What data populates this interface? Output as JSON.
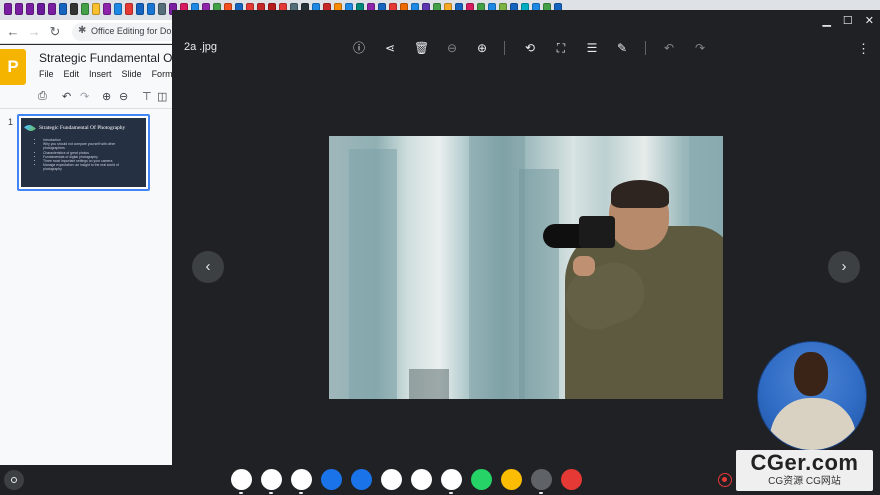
{
  "browser": {
    "tab_colors": [
      "#7b1fa2",
      "#7b1fa2",
      "#7b1fa2",
      "#6a1b9a",
      "#7b1fa2",
      "#1565c0",
      "#333333",
      "#43a047",
      "#fbc02d",
      "#8e24aa",
      "#1e88e5",
      "#e53935",
      "#1565c0",
      "#1976d2",
      "#546e7a",
      "#7b1fa2",
      "#d81b60",
      "#1e88e5",
      "#8e24aa",
      "#43a047",
      "#f4511e",
      "#1565c0",
      "#e53935",
      "#c62828",
      "#b71c1c",
      "#e53935",
      "#546e7a",
      "#263238",
      "#1e88e5",
      "#c62828",
      "#fb8c00",
      "#1e88e5",
      "#00897b",
      "#8e24aa",
      "#1565c0",
      "#e53935",
      "#ef6c00",
      "#1e88e5",
      "#5e35b1",
      "#43a047",
      "#f9a825",
      "#1565c0",
      "#d81b60",
      "#43a047",
      "#1e88e5",
      "#7cb342",
      "#1565c0",
      "#00acc1",
      "#1e88e5",
      "#43a047",
      "#1565c0"
    ],
    "tab_text": "Office Editing for Do",
    "tab_icon": "puzzle-icon"
  },
  "slides_app": {
    "logo_letter": "P",
    "title": "Strategic Fundamental Of",
    "menu": [
      "File",
      "Edit",
      "Insert",
      "Slide",
      "Forma"
    ],
    "slide_number": "1",
    "thumbnail": {
      "title": "Strategic Fundamental Of Photography",
      "bullets": [
        "Introduction",
        "Why you should not compare yourself with other photographers",
        "Characteristics of great photos",
        "Fundamentals of digital photography",
        "Three most important settings on your camera",
        "Manage expectation: an insight to the real world of photography"
      ]
    }
  },
  "viewer": {
    "filename": "2a .jpg",
    "toolbar_icons": [
      "info-icon",
      "share-icon",
      "delete-icon",
      "zoom-out-icon",
      "zoom-in-icon",
      "rotate-icon",
      "crop-icon",
      "adjust-icon",
      "annotate-icon",
      "undo-icon",
      "redo-icon"
    ],
    "photo_description_none": ""
  },
  "watermark": {
    "main": "CGer.com",
    "sub": "CG资源 CG网站"
  },
  "shelf": {
    "apps": [
      {
        "name": "chrome-app-icon",
        "color": "#ffffff"
      },
      {
        "name": "gmail-app-icon",
        "color": "#ffffff"
      },
      {
        "name": "calendar-app-icon",
        "color": "#ffffff"
      },
      {
        "name": "files-app-icon",
        "color": "#1a73e8"
      },
      {
        "name": "messages-app-icon",
        "color": "#1a73e8"
      },
      {
        "name": "meet-app-icon",
        "color": "#ffffff"
      },
      {
        "name": "play-store-app-icon",
        "color": "#ffffff"
      },
      {
        "name": "chrome-beta-app-icon",
        "color": "#ffffff"
      },
      {
        "name": "whatsapp-app-icon",
        "color": "#25d366"
      },
      {
        "name": "keep-app-icon",
        "color": "#fbbc04"
      },
      {
        "name": "settings-app-icon",
        "color": "#5f6368"
      },
      {
        "name": "screencast-app-icon",
        "color": "#e53935"
      }
    ]
  }
}
